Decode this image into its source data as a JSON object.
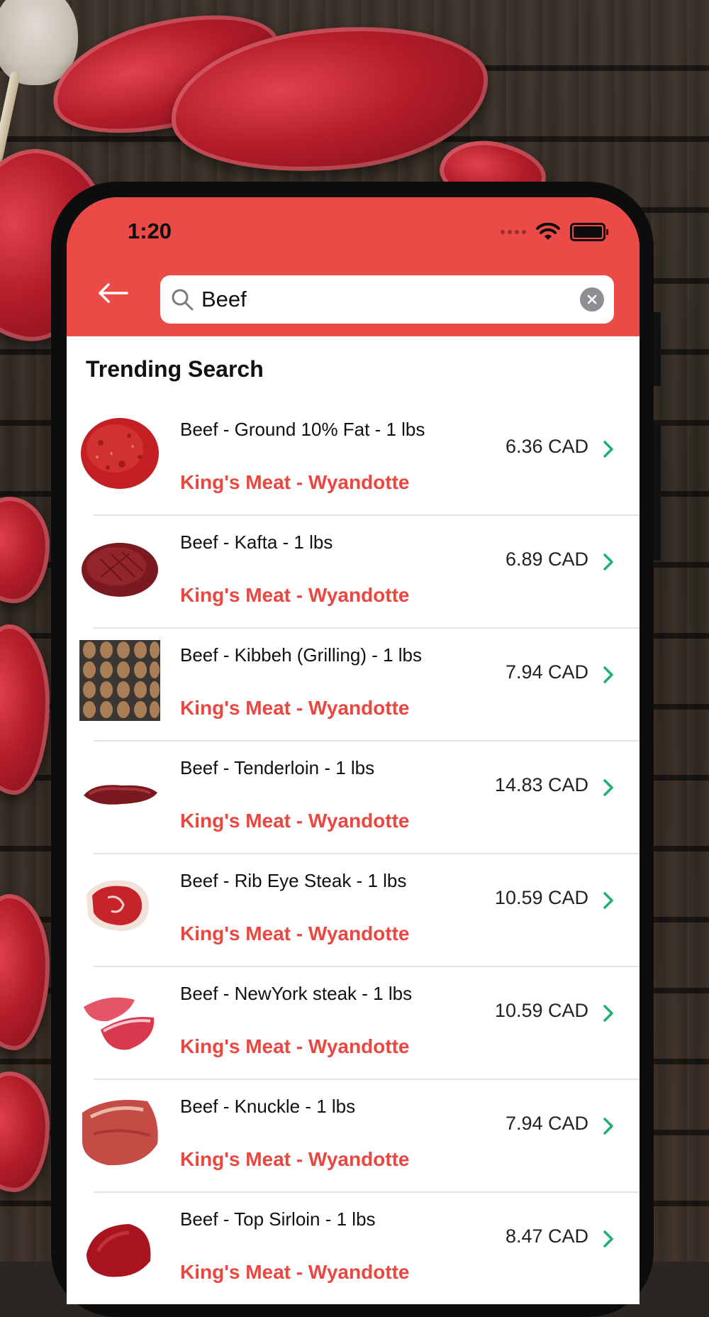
{
  "status_bar": {
    "time": "1:20"
  },
  "search": {
    "value": "Beef",
    "placeholder": ""
  },
  "section_title": "Trending Search",
  "colors": {
    "header": "#ec4a47",
    "store_text": "#e9473f",
    "chevron": "#1fae74"
  },
  "items": [
    {
      "name": "Beef - Ground 10% Fat - 1 lbs",
      "store": "King's Meat - Wyandotte",
      "price": "6.36 CAD",
      "thumb": "ground-beef"
    },
    {
      "name": "Beef - Kafta - 1 lbs",
      "store": "King's Meat - Wyandotte",
      "price": "6.89 CAD",
      "thumb": "kafta"
    },
    {
      "name": "Beef - Kibbeh (Grilling) - 1 lbs",
      "store": "King's Meat - Wyandotte",
      "price": "7.94 CAD",
      "thumb": "kibbeh"
    },
    {
      "name": "Beef - Tenderloin - 1 lbs",
      "store": "King's Meat - Wyandotte",
      "price": "14.83 CAD",
      "thumb": "tenderloin"
    },
    {
      "name": "Beef - Rib Eye Steak - 1 lbs",
      "store": "King's Meat - Wyandotte",
      "price": "10.59 CAD",
      "thumb": "rib-eye"
    },
    {
      "name": "Beef - NewYork steak - 1 lbs",
      "store": "King's Meat - Wyandotte",
      "price": "10.59 CAD",
      "thumb": "newyork-steak"
    },
    {
      "name": "Beef - Knuckle - 1 lbs",
      "store": "King's Meat - Wyandotte",
      "price": "7.94 CAD",
      "thumb": "knuckle"
    },
    {
      "name": "Beef - Top Sirloin - 1 lbs",
      "store": "King's Meat - Wyandotte",
      "price": "8.47 CAD",
      "thumb": "top-sirloin"
    }
  ]
}
